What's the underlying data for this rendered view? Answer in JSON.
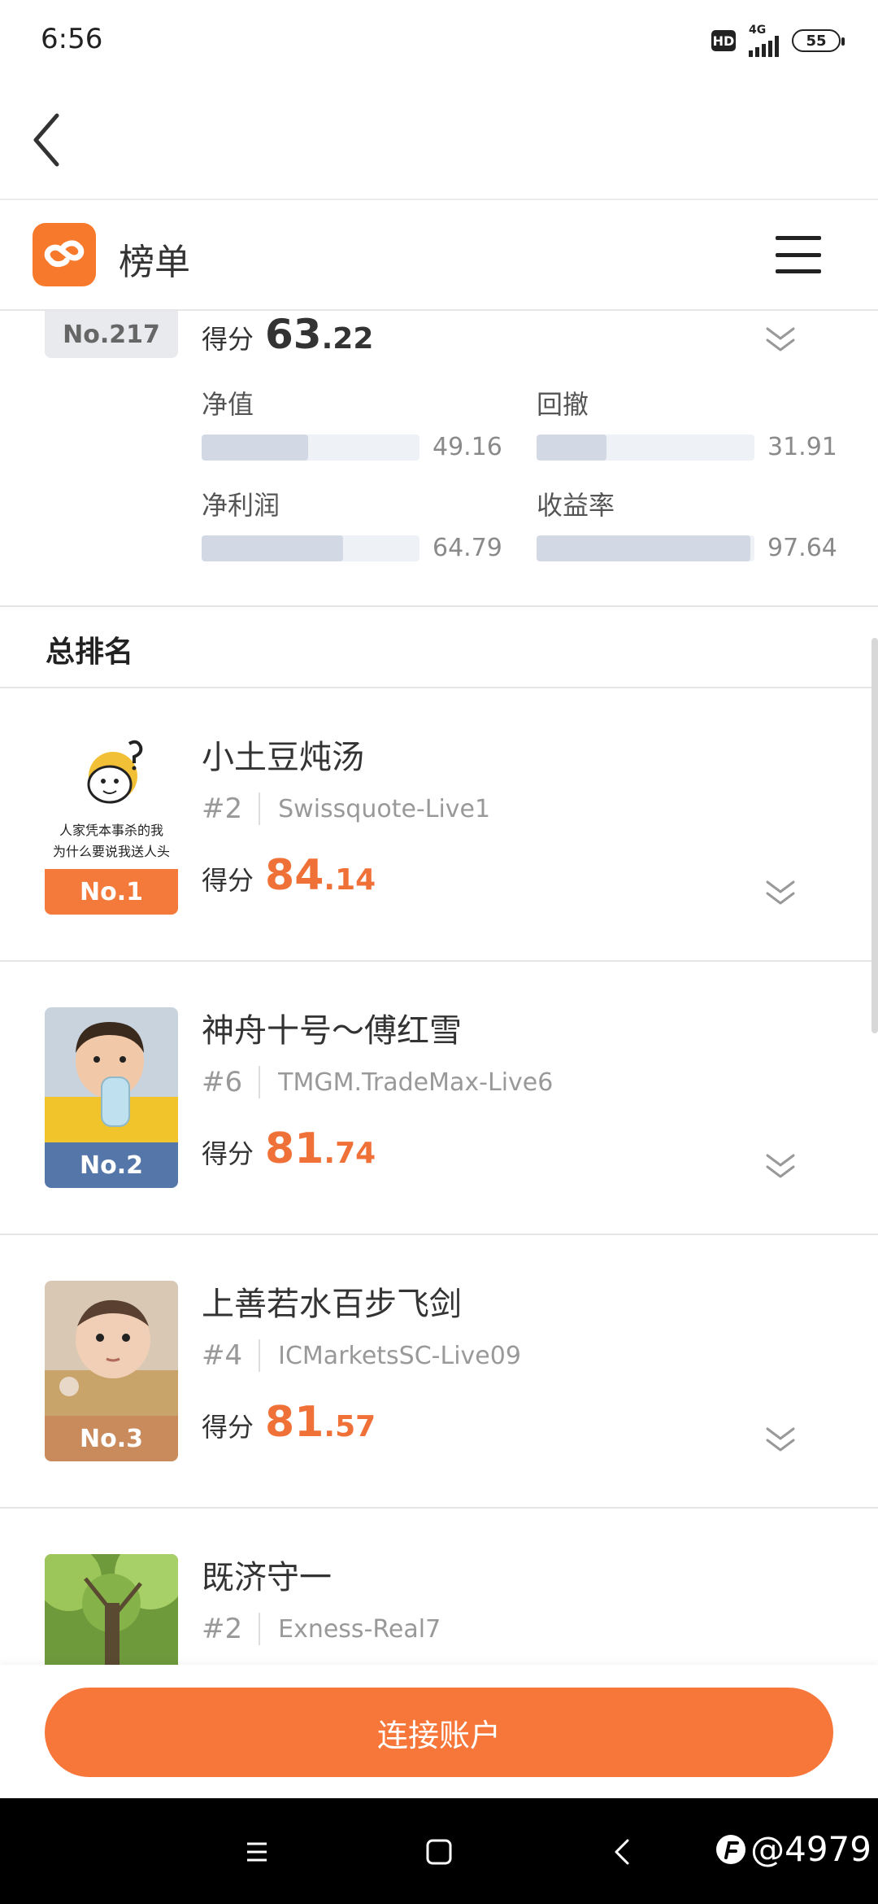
{
  "status_bar": {
    "time": "6:56",
    "hd": "HD",
    "network": "4G",
    "battery": "55"
  },
  "header": {
    "title": "榜单"
  },
  "my_rank": {
    "badge": "No.217",
    "score_label": "得分",
    "score_int": "63",
    "score_dec": ".22",
    "metrics": [
      {
        "label": "净值",
        "value": "49.16",
        "fill": 0.49
      },
      {
        "label": "回撤",
        "value": "31.91",
        "fill": 0.32
      },
      {
        "label": "净利润",
        "value": "64.79",
        "fill": 0.65
      },
      {
        "label": "收益率",
        "value": "97.64",
        "fill": 0.98
      }
    ]
  },
  "section": {
    "title": "总排名"
  },
  "avatar_caption": [
    "人家凭本事杀的我",
    "为什么要说我送人头"
  ],
  "rank_list": [
    {
      "badge": "No.1",
      "badge_color": "#f47a3c",
      "name": "小土豆炖汤",
      "rank": "#2",
      "server": "Swissquote-Live1",
      "score_label": "得分",
      "score_int": "84",
      "score_dec": ".14"
    },
    {
      "badge": "No.2",
      "badge_color": "#5576a8",
      "name": "神舟十号～傅红雪",
      "rank": "#6",
      "server": "TMGM.TradeMax-Live6",
      "score_label": "得分",
      "score_int": "81",
      "score_dec": ".74"
    },
    {
      "badge": "No.3",
      "badge_color": "#c98a5c",
      "name": "上善若水百步飞剑",
      "rank": "#4",
      "server": "ICMarketsSC-Live09",
      "score_label": "得分",
      "score_int": "81",
      "score_dec": ".57"
    },
    {
      "name": "既济守一",
      "rank": "#2",
      "server": "Exness-Real7"
    }
  ],
  "connect_button": "连接账户",
  "watermark": "@4979",
  "colors": {
    "accent": "#f7773a",
    "score": "#f07137"
  }
}
